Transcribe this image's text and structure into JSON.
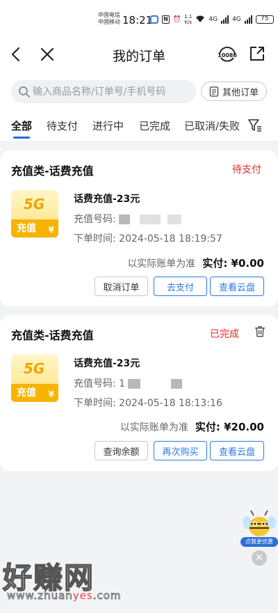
{
  "status_bar": {
    "carrier_1": "中国电信",
    "carrier_2": "中国移动",
    "time": "18:21",
    "net_speed_1": "1.1",
    "net_speed_2": "K/s",
    "signal_1": "4G",
    "signal_2": "4G",
    "battery": "75"
  },
  "nav": {
    "title": "我的订单",
    "service_number": "10086"
  },
  "search": {
    "placeholder": "输入商品名称/订单号/手机号码",
    "other_orders_label": "其他订单"
  },
  "tabs": [
    {
      "label": "全部",
      "active": true
    },
    {
      "label": "待支付"
    },
    {
      "label": "进行中"
    },
    {
      "label": "已完成"
    },
    {
      "label": "已取消/失败"
    }
  ],
  "orders": [
    {
      "category": "充值类-话费充值",
      "status": "待支付",
      "thumb_badge": "5G",
      "thumb_text": "充值",
      "thumb_yen": "¥",
      "product": "话费充值-23元",
      "phone_label": "充值号码: ",
      "time_label": "下单时间: ",
      "time": "2024-05-18 18:19:57",
      "note": "以实际账单为准",
      "paid_label": "实付:",
      "paid_amount": "¥0.00",
      "buttons": [
        "取消订单",
        "去支付",
        "查看云盘"
      ]
    },
    {
      "category": "充值类-话费充值",
      "status": "已完成",
      "thumb_badge": "5G",
      "thumb_text": "充值",
      "thumb_yen": "¥",
      "product": "话费充值-23元",
      "phone_label": "充值号码: ",
      "phone_visible": "1",
      "time_label": "下单时间: ",
      "time": "2024-05-18 18:13:16",
      "note": "以实际账单为准",
      "paid_label": "实付:",
      "paid_amount": "¥20.00",
      "buttons": [
        "查询余额",
        "再次购买",
        "查看云盘"
      ]
    }
  ],
  "promo": {
    "label": "点我更优惠",
    "close_glyph": "✕"
  },
  "watermark": {
    "title": "好赚网",
    "url_prefix": "www.zhuan",
    "url_highlight": "yes",
    "url_suffix": ".com"
  },
  "colors": {
    "accent_blue": "#2b78e4",
    "status_red": "#e02a2a",
    "thumb_yellow": "#f6b400"
  }
}
